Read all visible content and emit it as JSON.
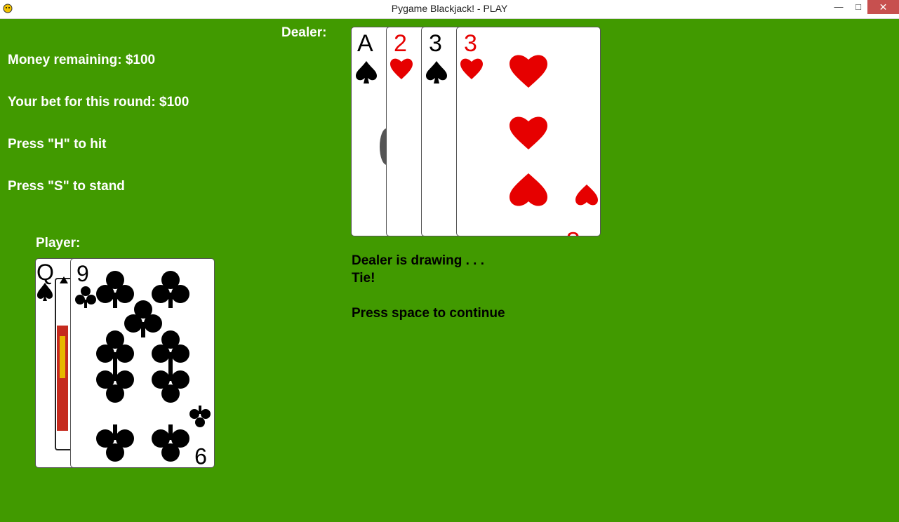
{
  "window": {
    "title": "Pygame Blackjack! - PLAY"
  },
  "hud": {
    "money": "Money remaining: $100",
    "bet": "Your bet for this round: $100",
    "hit_hint": "Press \"H\" to hit",
    "stand_hint": "Press \"S\" to stand"
  },
  "dealer": {
    "label": "Dealer:",
    "cards": [
      {
        "rank": "A",
        "suit": "spades",
        "color": "#000000"
      },
      {
        "rank": "2",
        "suit": "hearts",
        "color": "#e60000"
      },
      {
        "rank": "3",
        "suit": "spades",
        "color": "#000000"
      },
      {
        "rank": "3",
        "suit": "hearts",
        "color": "#e60000"
      }
    ]
  },
  "player": {
    "label": "Player:",
    "cards": [
      {
        "rank": "Q",
        "suit": "spades",
        "color": "#000000"
      },
      {
        "rank": "9",
        "suit": "clubs",
        "color": "#000000"
      }
    ]
  },
  "messages": {
    "drawing": "Dealer is drawing . . .",
    "result": "Tie!",
    "continue": "Press space to continue"
  },
  "colors": {
    "table": "#419a00",
    "red_suit": "#e60000",
    "black_suit": "#000000"
  }
}
